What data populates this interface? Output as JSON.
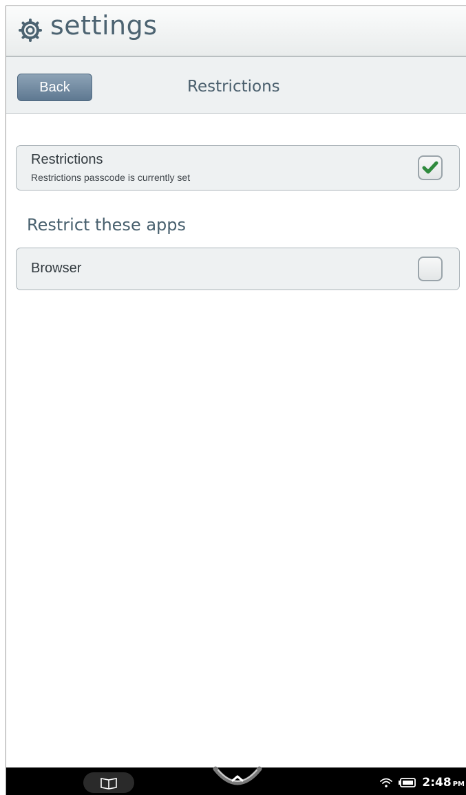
{
  "titlebar": {
    "icon": "gear-icon",
    "title": "settings"
  },
  "navbar": {
    "back_label": "Back",
    "title": "Restrictions"
  },
  "restrictions_row": {
    "label": "Restrictions",
    "subtitle": "Restrictions passcode is currently set",
    "checked": true
  },
  "section": {
    "heading": "Restrict these apps"
  },
  "apps": [
    {
      "label": "Browser",
      "checked": false
    }
  ],
  "statusbar": {
    "time": "2:48",
    "ampm": "PM",
    "icons": [
      "wifi-icon",
      "battery-icon"
    ],
    "nav_icons": [
      "book-icon",
      "home-chevron-icon"
    ]
  },
  "colors": {
    "accent_check": "#2f8a3d",
    "title_text": "#4c6371",
    "back_button": "#6f879d"
  }
}
